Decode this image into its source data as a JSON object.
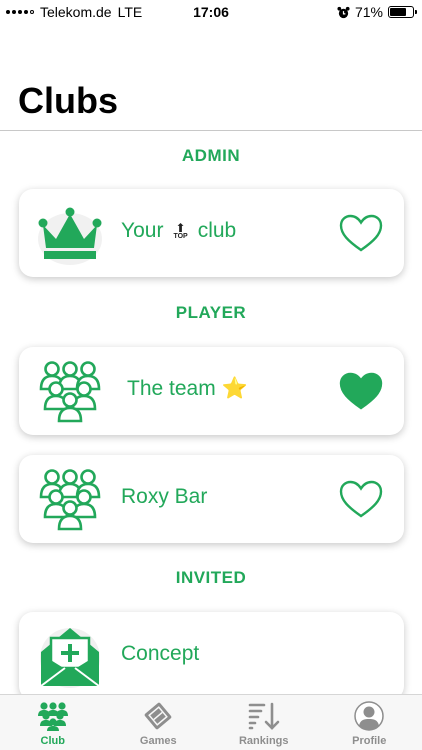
{
  "status_bar": {
    "carrier": "Telekom.de",
    "network": "LTE",
    "time": "17:06",
    "battery_percent": "71%",
    "battery_level": 0.71
  },
  "page": {
    "title": "Clubs"
  },
  "colors": {
    "accent": "#22a85a",
    "tab_inactive": "#8e8e8e"
  },
  "sections": {
    "admin": {
      "header": "ADMIN",
      "clubs": [
        {
          "name_part1": "Your",
          "badge_text": "TOP",
          "name_part2": "club",
          "icon": "crown-icon",
          "favorite": false
        }
      ]
    },
    "player": {
      "header": "PLAYER",
      "clubs": [
        {
          "name": "The team",
          "emoji": "⭐",
          "icon": "group-icon",
          "favorite": true
        },
        {
          "name": "Roxy Bar",
          "icon": "group-icon",
          "favorite": false
        }
      ]
    },
    "invited": {
      "header": "INVITED",
      "clubs": [
        {
          "name": "Concept",
          "icon": "envelope-plus-icon"
        }
      ]
    }
  },
  "tab_bar": {
    "tabs": [
      {
        "label": "Club",
        "icon": "club-icon",
        "active": true
      },
      {
        "label": "Games",
        "icon": "games-icon",
        "active": false
      },
      {
        "label": "Rankings",
        "icon": "rankings-icon",
        "active": false
      },
      {
        "label": "Profile",
        "icon": "profile-icon",
        "active": false
      }
    ]
  }
}
